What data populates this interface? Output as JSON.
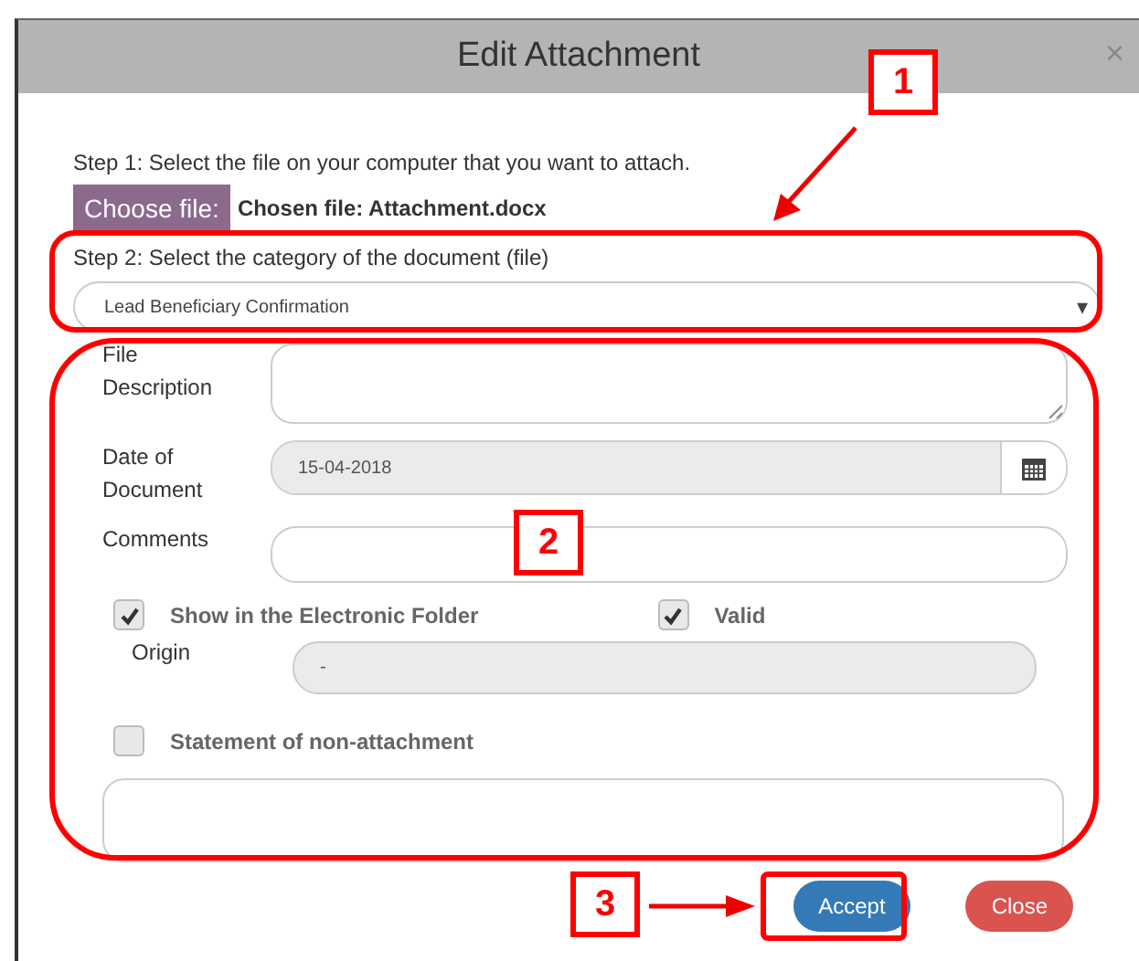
{
  "window": {
    "title": "Edit Attachment",
    "close": "×"
  },
  "step1": {
    "text": "Step 1: Select the file on your computer that you want to attach.",
    "button": "Choose file:",
    "chosen": "Chosen file: Attachment.docx"
  },
  "step2": {
    "text": "Step 2: Select the category of the document (file)",
    "value": "Lead Beneficiary Confirmation",
    "caret": "▾"
  },
  "fields": [
    {
      "kind": "textarea",
      "label": "File Description"
    },
    {
      "kind": "date",
      "label": "Date of Document",
      "value": "15-04-2018"
    },
    {
      "kind": "text",
      "label": "Comments"
    }
  ],
  "checks": [
    {
      "label": "Show in the Electronic Folder",
      "checked": true
    },
    {
      "label": "Valid",
      "checked": true
    }
  ],
  "origin": {
    "label": "Origin",
    "value": "-"
  },
  "statement": {
    "label": "Statement of non-attachment",
    "checked": false
  },
  "buttons": [
    {
      "label": "Accept",
      "kind": "primary"
    },
    {
      "label": "Close",
      "kind": "danger"
    }
  ],
  "annotations": [
    {
      "label": "1"
    },
    {
      "label": "2"
    },
    {
      "label": "3"
    }
  ]
}
